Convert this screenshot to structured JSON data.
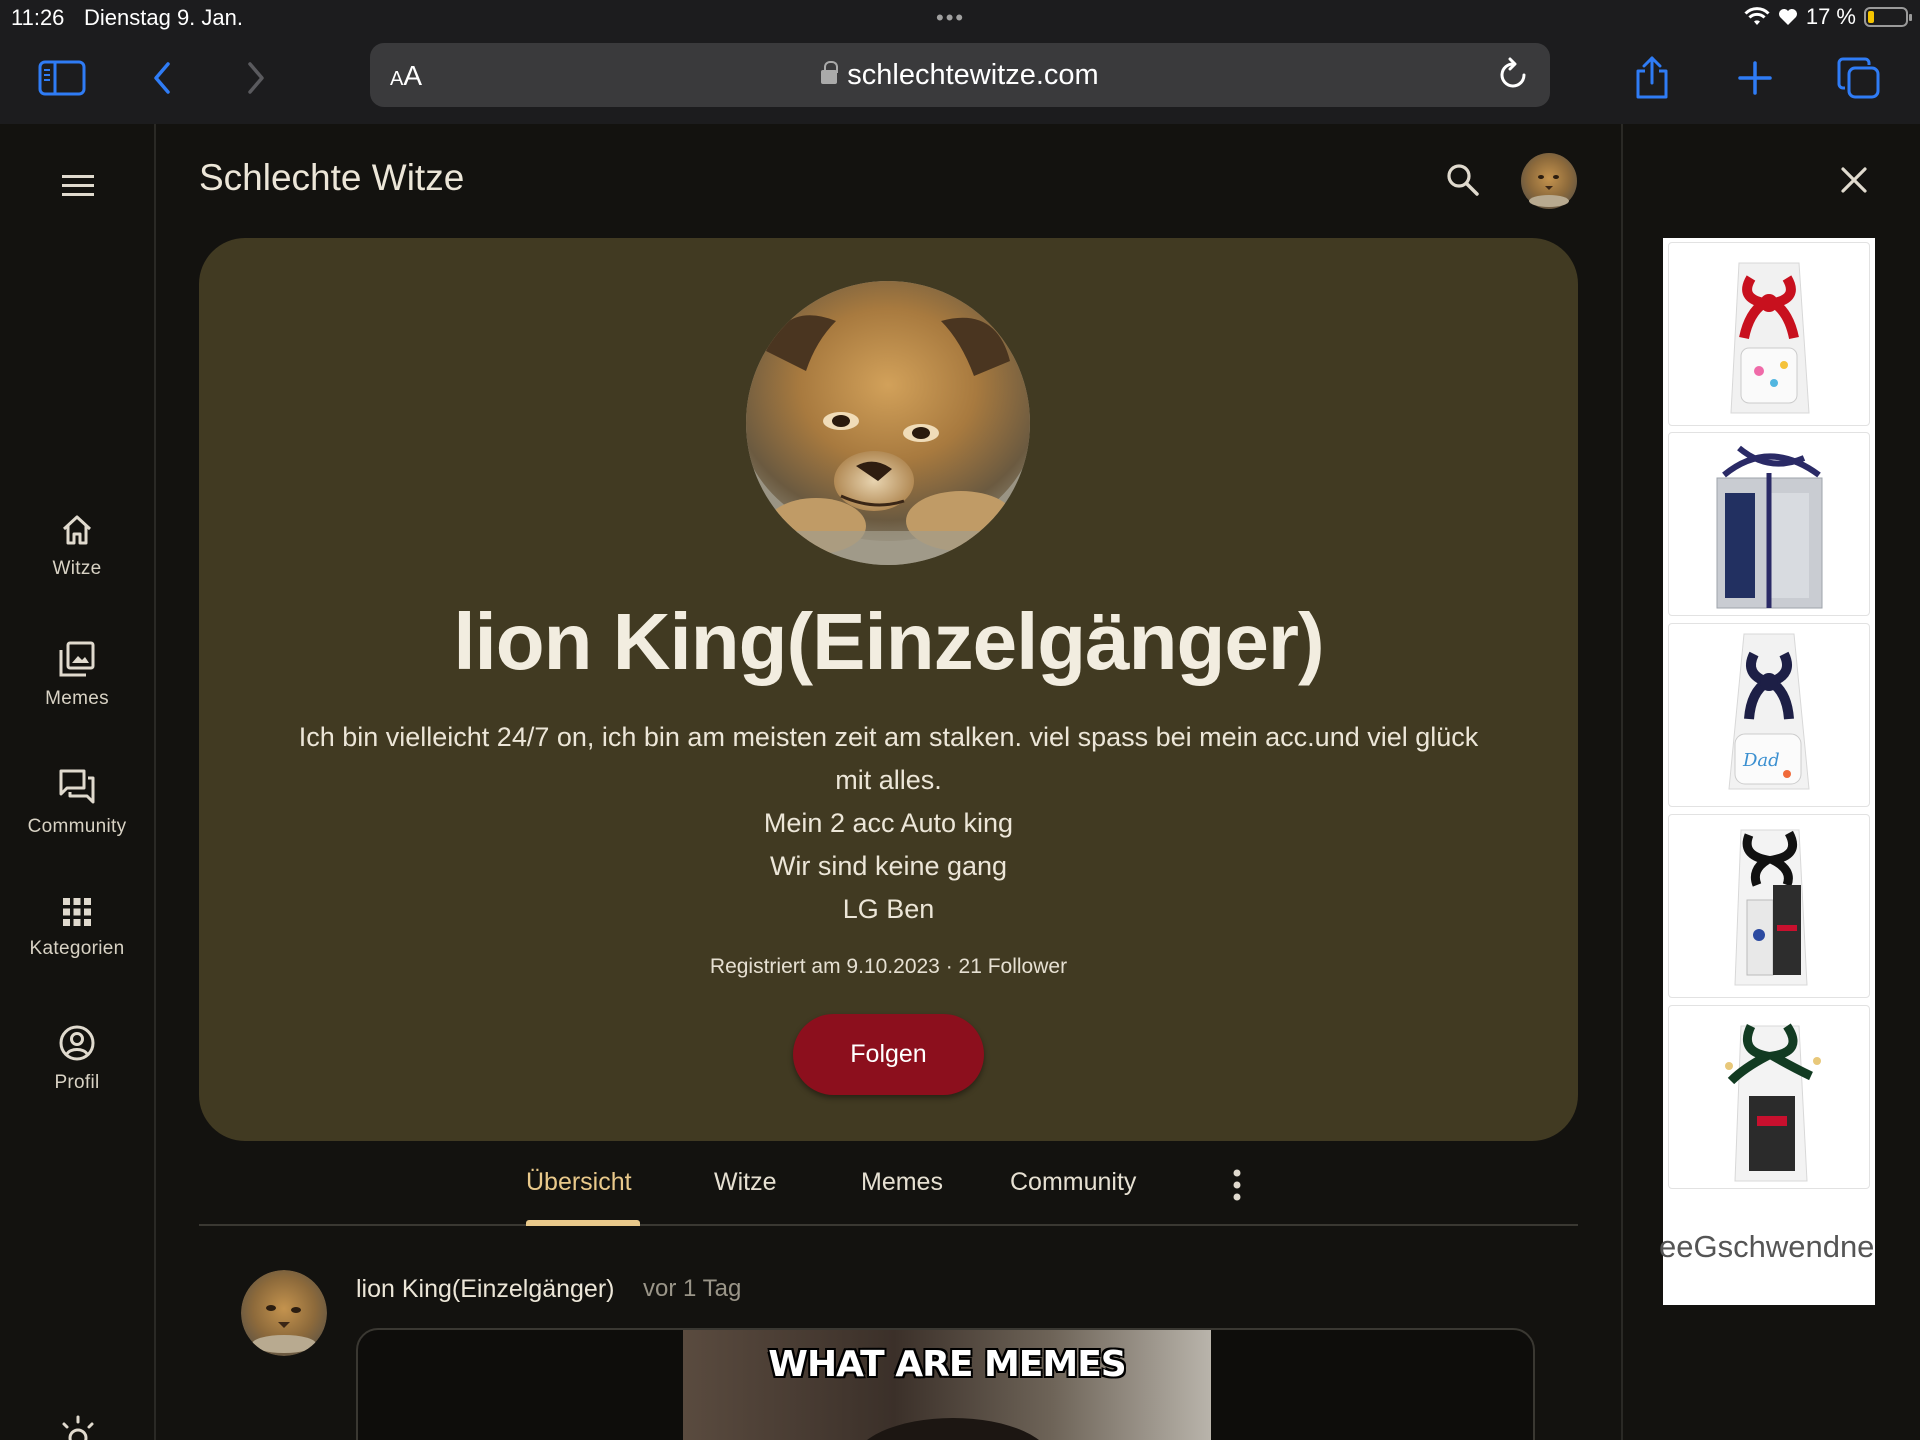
{
  "statusbar": {
    "time": "11:26",
    "date": "Dienstag 9. Jan.",
    "battery": "17 %"
  },
  "browser": {
    "text_size_label": "AA",
    "url": "schlechtewitze.com"
  },
  "site": {
    "title": "Schlechte Witze"
  },
  "nav": [
    {
      "label": "Witze",
      "icon": "home-icon"
    },
    {
      "label": "Memes",
      "icon": "image-gallery-icon"
    },
    {
      "label": "Community",
      "icon": "chat-icon"
    },
    {
      "label": "Kategorien",
      "icon": "grid-icon"
    },
    {
      "label": "Profil",
      "icon": "account-circle-icon"
    }
  ],
  "profile": {
    "name": "lion King(Einzelgänger)",
    "bio": [
      "Ich bin vielleicht 24/7 on, ich bin am meisten zeit am stalken. viel spass bei mein acc.und viel glück",
      "mit alles.",
      "Mein 2 acc Auto king",
      "Wir sind keine gang",
      "LG Ben"
    ],
    "meta": "Registriert am 9.10.2023 · 21 Follower",
    "follow_label": "Folgen"
  },
  "tabs": [
    {
      "label": "Übersicht",
      "active": true
    },
    {
      "label": "Witze",
      "active": false
    },
    {
      "label": "Memes",
      "active": false
    },
    {
      "label": "Community",
      "active": false
    }
  ],
  "post": {
    "author": "lion King(Einzelgänger)",
    "time": "vor 1 Tag",
    "meme_caption": "WHAT ARE MEMES"
  },
  "ad": {
    "text": "eeGschwendne"
  },
  "colors": {
    "card": "#413a22",
    "accent": "#e9c98b",
    "follow": "#8c0f1d",
    "ios_blue": "#2f7cf6"
  }
}
